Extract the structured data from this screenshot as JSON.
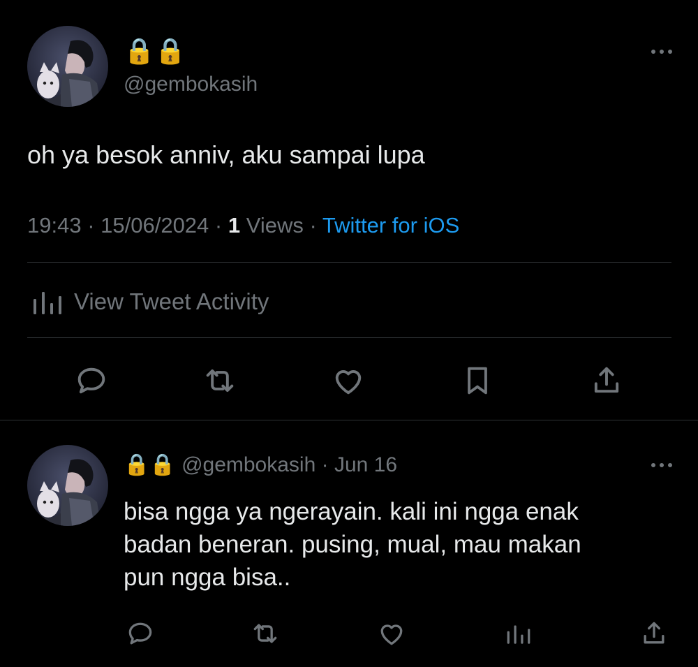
{
  "tweet": {
    "display_name": "🔒🔒",
    "handle": "@gembokasih",
    "text": "oh ya besok anniv, aku sampai lupa",
    "time": "19:43",
    "date": "15/06/2024",
    "views_count": "1",
    "views_label": "Views",
    "source": "Twitter for iOS",
    "activity_label": "View Tweet Activity",
    "actions": [
      "reply-icon",
      "retweet-icon",
      "like-icon",
      "bookmark-icon",
      "share-icon"
    ]
  },
  "reply": {
    "display_name": "🔒🔒",
    "handle": "@gembokasih",
    "date": "Jun 16",
    "text_lines": [
      "bisa ngga ya ngerayain. kali ini ngga enak",
      "badan beneran. pusing, mual, mau makan",
      "pun ngga bisa.."
    ],
    "actions": [
      "reply-icon",
      "retweet-icon",
      "like-icon",
      "views-icon",
      "share-icon"
    ]
  },
  "colors": {
    "background": "#000000",
    "text": "#e7e9ea",
    "muted": "#71767b",
    "link": "#1d9bf0",
    "divider": "#2f3336",
    "lock_gold": "#d7b25a"
  }
}
